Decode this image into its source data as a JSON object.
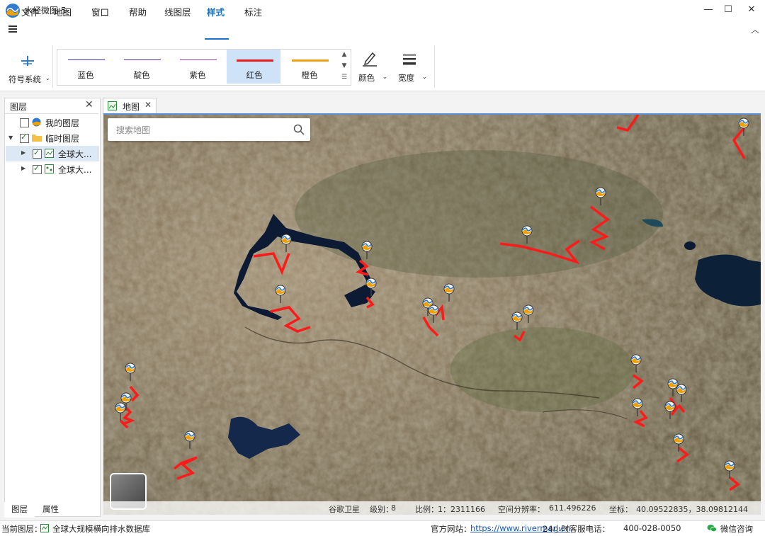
{
  "window": {
    "title": "水经微图 5",
    "controls": {
      "minimize": "—",
      "maximize": "☐",
      "close": "✕"
    }
  },
  "menu": {
    "items": [
      "文件",
      "地图",
      "窗口",
      "帮助",
      "线图层",
      "样式",
      "标注"
    ],
    "active": "样式",
    "collapse_icon": "chevron-up-icon"
  },
  "ribbon": {
    "symbol_system": {
      "label": "符号系统",
      "icon": "symbol-system-icon"
    },
    "line_styles": [
      {
        "label": "蓝色",
        "color": "#3a3ab8",
        "width": 1
      },
      {
        "label": "靛色",
        "color": "#5a2aa0",
        "width": 1
      },
      {
        "label": "紫色",
        "color": "#9b3fb8",
        "width": 1
      },
      {
        "label": "红色",
        "color": "#e81818",
        "width": 3,
        "selected": true
      },
      {
        "label": "橙色",
        "color": "#f0a010",
        "width": 3
      }
    ],
    "color_button": {
      "label": "颜色",
      "icon": "pen-color-icon"
    },
    "width_button": {
      "label": "宽度",
      "icon": "line-width-icon"
    }
  },
  "layers_panel": {
    "title": "图层",
    "items": [
      {
        "label": "我的图层",
        "checked": false,
        "icon": "app-globe-icon"
      },
      {
        "label": "临时图层",
        "checked": true,
        "icon": "folder-icon",
        "expanded": true
      },
      {
        "label": "全球大...",
        "checked": true,
        "icon": "line-layer-icon",
        "selected": true
      },
      {
        "label": "全球大...",
        "checked": true,
        "icon": "point-layer-icon"
      }
    ],
    "tabs": [
      "图层",
      "属性"
    ]
  },
  "map_tab": {
    "label": "地图"
  },
  "search": {
    "placeholder": "搜索地图"
  },
  "map_status": {
    "basemap": "谷歌卫星",
    "level_label": "级别：",
    "level": "8",
    "scale_label": "比例：",
    "scale": "1：2311166",
    "resolution_label": "空间分辨率：",
    "resolution": "611.496226",
    "coord_label": "坐标：",
    "coords": "40.09522835，38.09812144"
  },
  "statusbar": {
    "current_layer_label": "当前图层：",
    "current_layer": "全球大规模横向排水数据库",
    "site_label": "官方网站：",
    "site_url": "https://www.rivermap.cn",
    "hotline": "24小时客服电话：",
    "phone": "400-028-0050",
    "wechat": "微信咨询"
  },
  "map_overlay": {
    "route_color": "#ff1a1a",
    "water_color": "#0c1a33"
  }
}
